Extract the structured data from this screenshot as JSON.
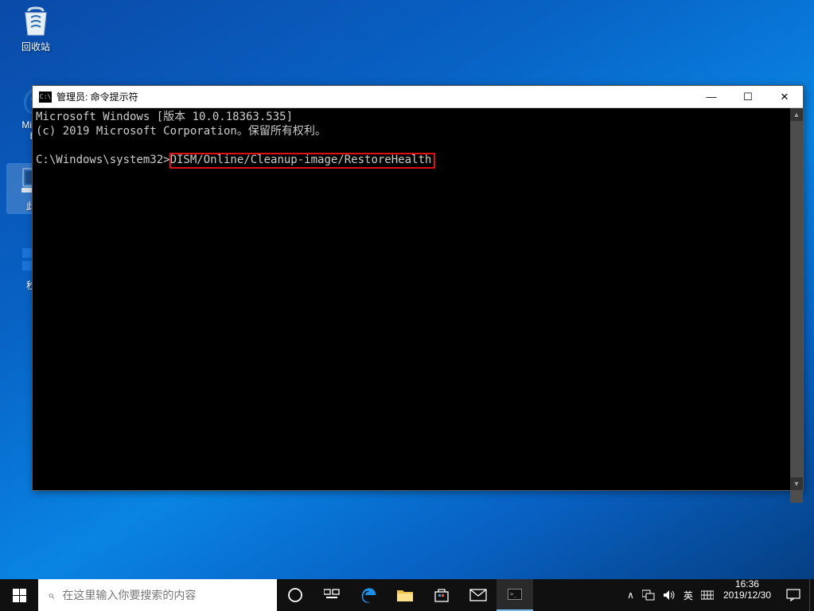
{
  "desktop": {
    "icons": [
      {
        "id": "recycle",
        "label": "回收站"
      },
      {
        "id": "edge",
        "label": "Micros\nEd"
      },
      {
        "id": "thispc",
        "label": "此电",
        "selected": true
      },
      {
        "id": "shutdown",
        "label": "秒关"
      }
    ]
  },
  "window": {
    "title": "管理员: 命令提示符",
    "icon_glyph": "C:\\",
    "terminal": {
      "line1": "Microsoft Windows [版本 10.0.18363.535]",
      "line2": "(c) 2019 Microsoft Corporation。保留所有权利。",
      "prompt": "C:\\Windows\\system32>",
      "command": "DISM/Online/Cleanup-image/RestoreHealth"
    },
    "buttons": {
      "min": "—",
      "max": "☐",
      "close": "✕"
    }
  },
  "taskbar": {
    "search_placeholder": "在这里输入你要搜索的内容",
    "items": [
      {
        "id": "cortana",
        "glyph": "◯"
      },
      {
        "id": "taskview",
        "glyph": "⧉"
      },
      {
        "id": "edge",
        "glyph": "e"
      },
      {
        "id": "explorer",
        "glyph": "folder"
      },
      {
        "id": "store",
        "glyph": "store"
      },
      {
        "id": "mail",
        "glyph": "✉"
      },
      {
        "id": "cmd",
        "glyph": "cmd",
        "active": true
      }
    ],
    "tray": {
      "expand": "∧",
      "network": "net",
      "volume": "vol",
      "ime1": "英",
      "ime2": "⌨",
      "time": "16:36",
      "date": "2019/12/30",
      "notification": "notif"
    }
  }
}
